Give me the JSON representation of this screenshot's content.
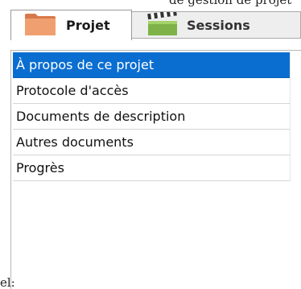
{
  "colors": {
    "selection": "#0a6ed1",
    "folder": "#e8895a",
    "clapper": "#8fbf4f"
  },
  "tabs": [
    {
      "label": "Projet",
      "icon": "folder-icon",
      "active": true
    },
    {
      "label": "Sessions",
      "icon": "clapperboard-icon",
      "active": false
    }
  ],
  "sidebar": {
    "items": [
      {
        "label": "À propos de ce projet",
        "selected": true
      },
      {
        "label": "Protocole d'accès",
        "selected": false
      },
      {
        "label": "Documents de description",
        "selected": false
      },
      {
        "label": "Autres documents",
        "selected": false
      },
      {
        "label": "Progrès",
        "selected": false
      }
    ]
  },
  "fragments": {
    "top_clipped": "de gestion de projet",
    "bottom_left": "el:"
  }
}
